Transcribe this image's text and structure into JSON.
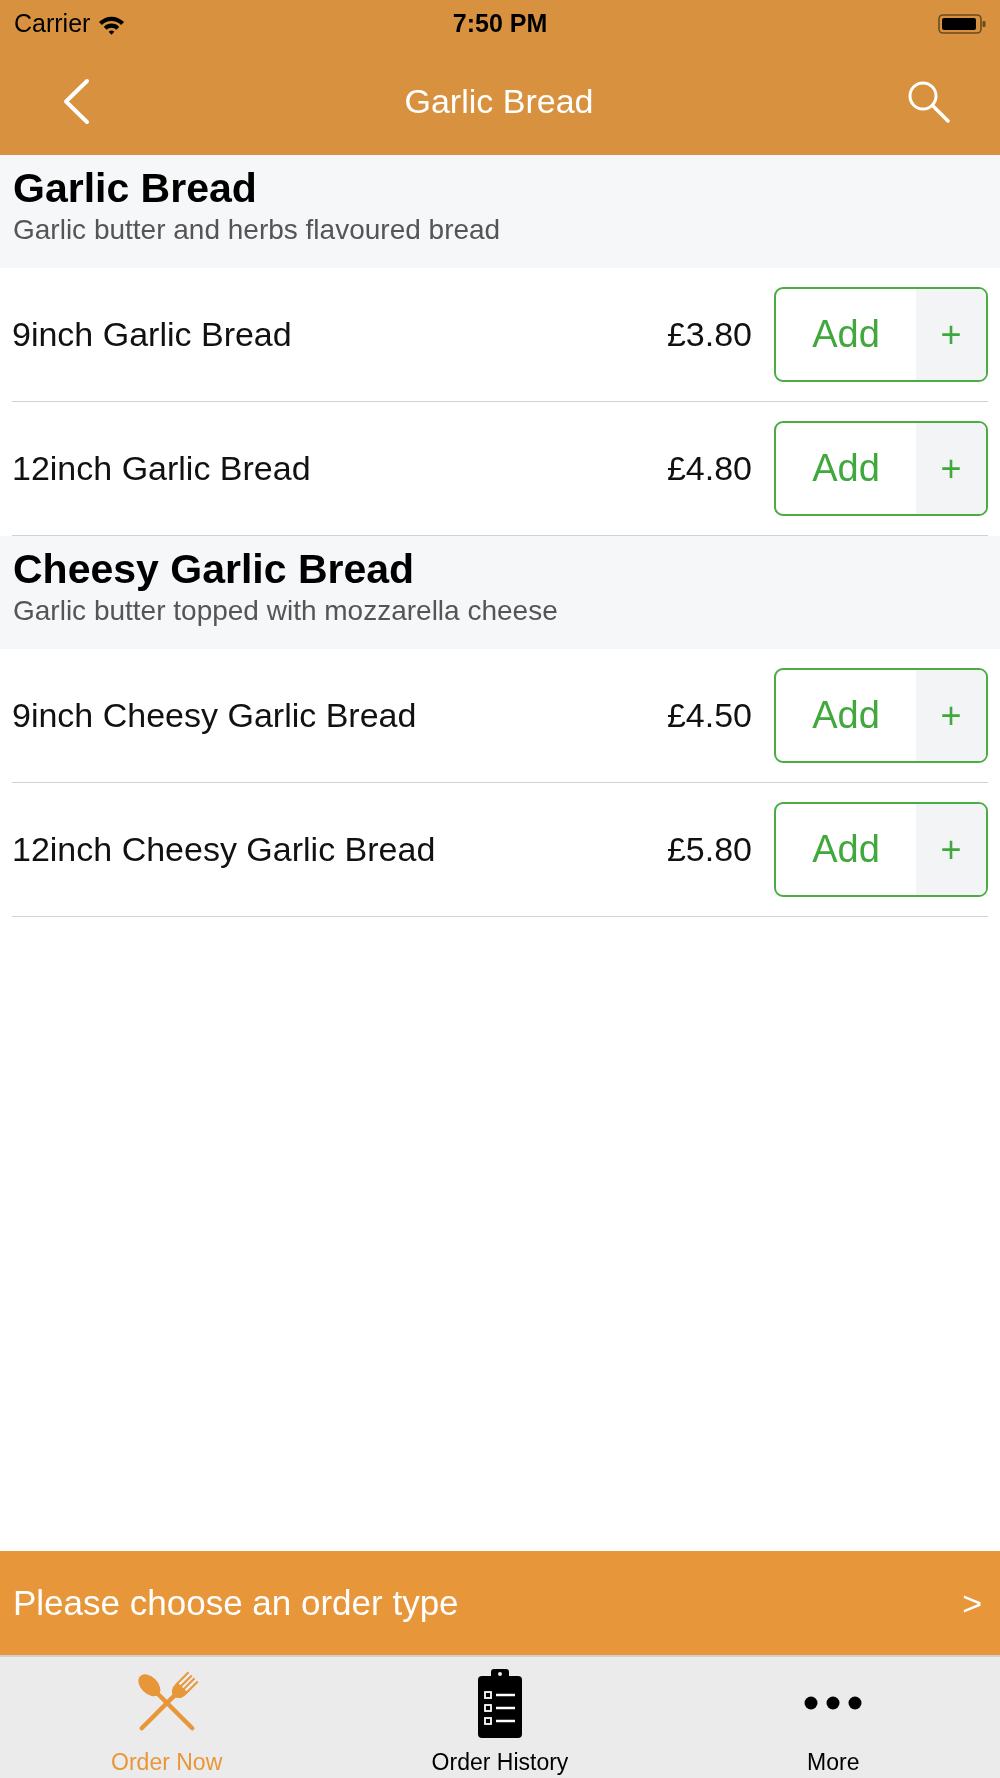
{
  "status_bar": {
    "carrier": "Carrier",
    "time": "7:50 PM"
  },
  "nav_bar": {
    "title": "Garlic Bread"
  },
  "sections": [
    {
      "title": "Garlic Bread",
      "description": "Garlic butter and herbs flavoured bread",
      "items": [
        {
          "name": "9inch Garlic Bread",
          "price": "£3.80",
          "button_label": "Add",
          "button_symbol": "+"
        },
        {
          "name": "12inch Garlic Bread",
          "price": "£4.80",
          "button_label": "Add",
          "button_symbol": "+"
        }
      ]
    },
    {
      "title": "Cheesy Garlic Bread",
      "description": "Garlic butter topped with mozzarella cheese",
      "items": [
        {
          "name": "9inch Cheesy Garlic Bread",
          "price": "£4.50",
          "button_label": "Add",
          "button_symbol": "+"
        },
        {
          "name": "12inch Cheesy Garlic Bread",
          "price": "£5.80",
          "button_label": "Add",
          "button_symbol": "+"
        }
      ]
    }
  ],
  "order_type_bar": {
    "label": "Please choose an order type",
    "chevron": ">"
  },
  "tab_bar": [
    {
      "kind": "cutlery",
      "label": "Order Now",
      "selected": true
    },
    {
      "kind": "clipboard",
      "label": "Order History",
      "selected": false
    },
    {
      "kind": "more",
      "label": "More",
      "selected": false
    }
  ]
}
